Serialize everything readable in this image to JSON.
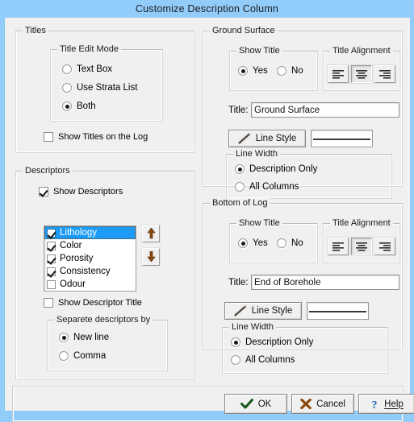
{
  "window": {
    "title": "Customize Description Column"
  },
  "titles": {
    "legend": "Titles",
    "edit_mode": {
      "legend": "Title Edit Mode",
      "options": [
        {
          "label": "Text Box",
          "selected": false
        },
        {
          "label": "Use Strata List",
          "selected": false
        },
        {
          "label": "Both",
          "selected": true
        }
      ]
    },
    "show_titles_on_log": {
      "label": "Show Titles on the Log",
      "checked": false
    }
  },
  "descriptors": {
    "legend": "Descriptors",
    "show_descriptors": {
      "label": "Show Descriptors",
      "checked": true
    },
    "items": [
      {
        "label": "Lithology",
        "checked": true,
        "selected": true
      },
      {
        "label": "Color",
        "checked": true,
        "selected": false
      },
      {
        "label": "Porosity",
        "checked": true,
        "selected": false
      },
      {
        "label": "Consistency",
        "checked": true,
        "selected": false
      },
      {
        "label": "Odour",
        "checked": false,
        "selected": false
      }
    ],
    "move_up": "move-up",
    "move_down": "move-down",
    "show_descriptor_title": {
      "label": "Show Descriptor Title",
      "checked": false
    },
    "separator": {
      "legend": "Separete descriptors  by",
      "options": [
        {
          "label": "New line",
          "selected": true
        },
        {
          "label": "Comma",
          "selected": false
        }
      ]
    }
  },
  "ground_surface": {
    "legend": "Ground Surface",
    "show_title": {
      "legend": "Show Title",
      "options": [
        {
          "label": "Yes",
          "selected": true
        },
        {
          "label": "No",
          "selected": false
        }
      ]
    },
    "title_alignment": {
      "legend": "Title Alignment",
      "options": [
        {
          "name": "align-left",
          "active": false
        },
        {
          "name": "align-center",
          "active": true
        },
        {
          "name": "align-right",
          "active": false
        }
      ]
    },
    "title_field": {
      "label": "Title:",
      "value": "Ground Surface"
    },
    "line_style_button": "Line Style",
    "line_width": {
      "legend": "Line Width",
      "options": [
        {
          "label": "Description Only",
          "selected": true
        },
        {
          "label": "All Columns",
          "selected": false
        }
      ]
    }
  },
  "bottom_of_log": {
    "legend": "Bottom of Log",
    "show_title": {
      "legend": "Show Title",
      "options": [
        {
          "label": "Yes",
          "selected": true
        },
        {
          "label": "No",
          "selected": false
        }
      ]
    },
    "title_alignment": {
      "legend": "Title Alignment",
      "options": [
        {
          "name": "align-left",
          "active": false
        },
        {
          "name": "align-center",
          "active": true
        },
        {
          "name": "align-right",
          "active": false
        }
      ]
    },
    "title_field": {
      "label": "Title:",
      "value": "End of Borehole"
    },
    "line_style_button": "Line Style",
    "line_width": {
      "legend": "Line Width",
      "options": [
        {
          "label": "Description Only",
          "selected": true
        },
        {
          "label": "All Columns",
          "selected": false
        }
      ]
    }
  },
  "actions": {
    "ok": "OK",
    "cancel": "Cancel",
    "help": "Help"
  },
  "colors": {
    "titlebar": "#92ccfb",
    "dialog": "#f0f0f0",
    "selection": "#1b9bf7",
    "arrow": "#8b4a10",
    "ok_check": "#14561a",
    "cancel_x": "#8b4a10",
    "help_q": "#1565c0"
  }
}
